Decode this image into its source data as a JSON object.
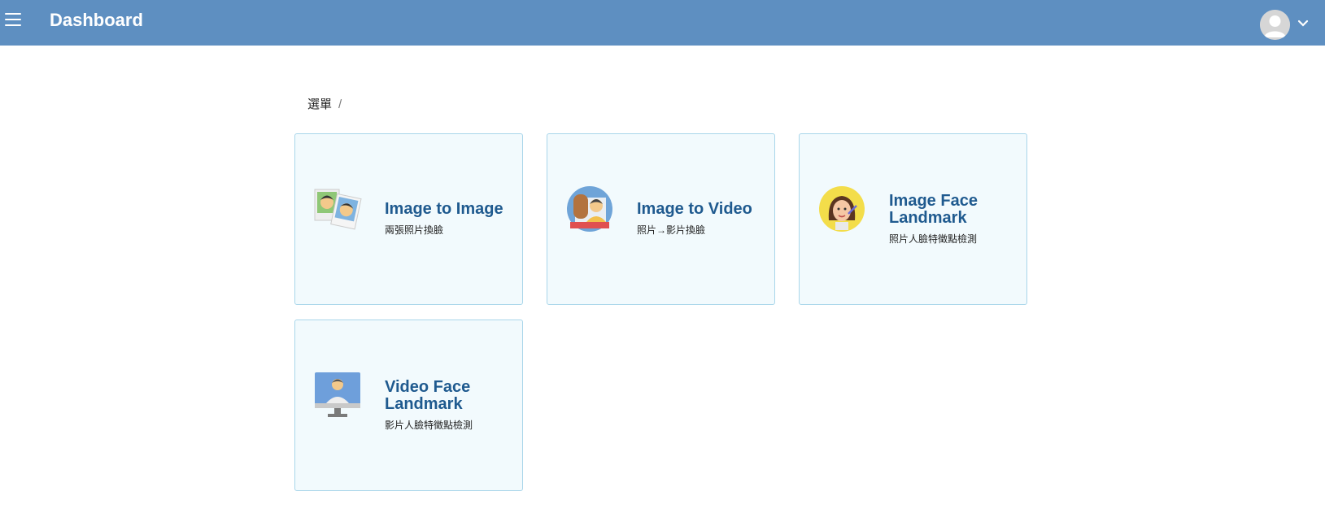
{
  "header": {
    "title": "Dashboard",
    "menu_icon": "hamburger-menu-icon",
    "avatar_icon": "user-avatar-icon",
    "chevron_icon": "chevron-down-icon",
    "background_color": "#5e8fc1"
  },
  "breadcrumb": {
    "item": "選單",
    "separator": "/"
  },
  "cards": [
    {
      "title": "Image to Image",
      "subtitle": "兩張照片換臉",
      "icon": "photo-pair-icon"
    },
    {
      "title": "Image to Video",
      "subtitle": "照片→影片換臉",
      "icon": "video-face-icon"
    },
    {
      "title": "Image Face Landmark",
      "subtitle": "照片人臉特徵點檢測",
      "icon": "face-landmark-icon"
    },
    {
      "title": "Video Face Landmark",
      "subtitle": "影片人臉特徵點檢測",
      "icon": "monitor-person-icon"
    }
  ],
  "colors": {
    "card_background": "#f2fafd",
    "card_border": "#a9d6ea",
    "card_title": "#1f5a8f"
  }
}
